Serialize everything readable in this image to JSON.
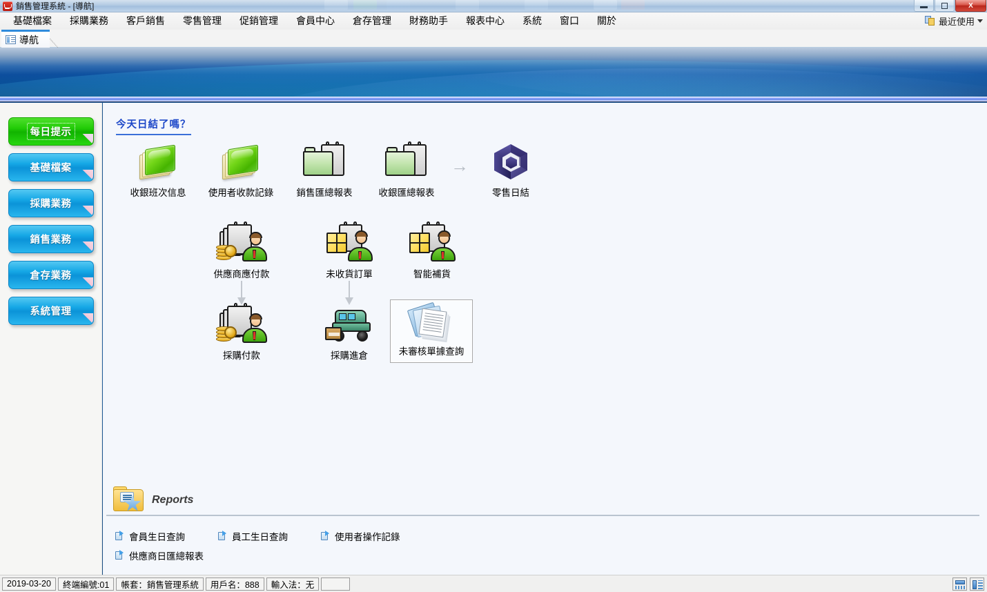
{
  "window": {
    "title": "銷售管理系統 - [導航]",
    "logo_icon": "cart-icon",
    "controls": [
      {
        "name": "minimize-button",
        "glyph": "minimize-icon"
      },
      {
        "name": "restore-button",
        "glyph": "restore-icon"
      },
      {
        "name": "close-button",
        "glyph": "close-icon",
        "label": "X"
      }
    ]
  },
  "menubar": {
    "items": [
      {
        "label": "基礎檔案",
        "name": "menu-base-file"
      },
      {
        "label": "採購業務",
        "name": "menu-purchasing"
      },
      {
        "label": "客戶銷售",
        "name": "menu-customer-sales"
      },
      {
        "label": "零售管理",
        "name": "menu-retail"
      },
      {
        "label": "促銷管理",
        "name": "menu-promotion"
      },
      {
        "label": "會員中心",
        "name": "menu-membership"
      },
      {
        "label": "倉存管理",
        "name": "menu-inventory"
      },
      {
        "label": "財務助手",
        "name": "menu-finance"
      },
      {
        "label": "報表中心",
        "name": "menu-reports"
      },
      {
        "label": "系統",
        "name": "menu-system"
      },
      {
        "label": "窗口",
        "name": "menu-window"
      },
      {
        "label": "關於",
        "name": "menu-about"
      }
    ],
    "recent": {
      "label": "最近使用",
      "icon": "copy-pages-icon",
      "caret": "chevron-down-icon"
    }
  },
  "tabs": [
    {
      "label": "導航",
      "name": "tab-navigation",
      "icon": "list-view-icon",
      "active": true
    }
  ],
  "sidebar": {
    "items": [
      {
        "label": "每日提示",
        "name": "sidebar-item-daily-tips",
        "color": "#1fc40a",
        "style": "green",
        "selected": true
      },
      {
        "label": "基礎檔案",
        "name": "sidebar-item-base-file",
        "color": "#0f93d8",
        "style": "blue",
        "selected": false
      },
      {
        "label": "採購業務",
        "name": "sidebar-item-purchasing",
        "color": "#0f93d8",
        "style": "blue",
        "selected": false
      },
      {
        "label": "銷售業務",
        "name": "sidebar-item-sales",
        "color": "#0f93d8",
        "style": "blue",
        "selected": false
      },
      {
        "label": "倉存業務",
        "name": "sidebar-item-inventory",
        "color": "#0f93d8",
        "style": "blue",
        "selected": false
      },
      {
        "label": "系統管理",
        "name": "sidebar-item-system-admin",
        "color": "#0f93d8",
        "style": "blue",
        "selected": false
      }
    ]
  },
  "main": {
    "section_title": "今天日結了嗎？",
    "row1": [
      {
        "label": "收銀班次信息",
        "name": "icon-cashier-shift-info",
        "art": "green-book-icon"
      },
      {
        "label": "使用者收款記錄",
        "name": "icon-user-payment-record",
        "art": "green-book-icon"
      },
      {
        "label": "銷售匯總報表",
        "name": "icon-sales-summary-report",
        "art": "clipboard-folder-icon"
      },
      {
        "label": "收銀匯總報表",
        "name": "icon-cashier-summary-report",
        "art": "clipboard-folder-icon"
      },
      {
        "label": "零售日結",
        "name": "icon-retail-daily-close",
        "art": "purple-cube-icon"
      }
    ],
    "row2": [
      {
        "label": "供應商應付款",
        "name": "icon-supplier-payable",
        "art": "clipboard-person-coins-icon"
      },
      {
        "label": "未收貨訂單",
        "name": "icon-unreceived-orders",
        "art": "box-person-icon"
      },
      {
        "label": "智能補貨",
        "name": "icon-smart-replenishment",
        "art": "box-person-icon"
      }
    ],
    "row3": [
      {
        "label": "採購付款",
        "name": "icon-purchase-payment",
        "art": "clipboard-person-coins-icon",
        "selected": false
      },
      {
        "label": "採購進倉",
        "name": "icon-purchase-receiving",
        "art": "truck-icon",
        "selected": false
      },
      {
        "label": "未審核單據查詢",
        "name": "icon-unapproved-document-query",
        "art": "document-stack-icon",
        "selected": true
      }
    ],
    "arrow_right": "→"
  },
  "reports": {
    "title": "Reports",
    "folder_icon": "folder-star-icon",
    "links": [
      {
        "label": "會員生日查詢",
        "name": "report-link-member-birthday"
      },
      {
        "label": "員工生日查詢",
        "name": "report-link-staff-birthday"
      },
      {
        "label": "使用者操作記錄",
        "name": "report-link-user-operation-log"
      },
      {
        "label": "供應商日匯總報表",
        "name": "report-link-supplier-daily-summary"
      }
    ]
  },
  "statusbar": {
    "cells": [
      {
        "text": "2019-03-20",
        "name": "status-date"
      },
      {
        "text": "終端編號:01",
        "name": "status-terminal-id"
      },
      {
        "text": "帳套：銷售管理系統",
        "name": "status-account-set"
      },
      {
        "text": "用戶名：888",
        "name": "status-username"
      },
      {
        "text": "輸入法：无",
        "name": "status-input-method"
      }
    ],
    "right_icons": [
      {
        "name": "layout-horizontal-icon"
      },
      {
        "name": "layout-vertical-icon"
      }
    ]
  },
  "colors": {
    "accent_blue": "#0d4f9e",
    "content_bg": "#f4f7fc",
    "sidebar_bg": "#f6f6f4",
    "title_link": "#1c47c8"
  }
}
